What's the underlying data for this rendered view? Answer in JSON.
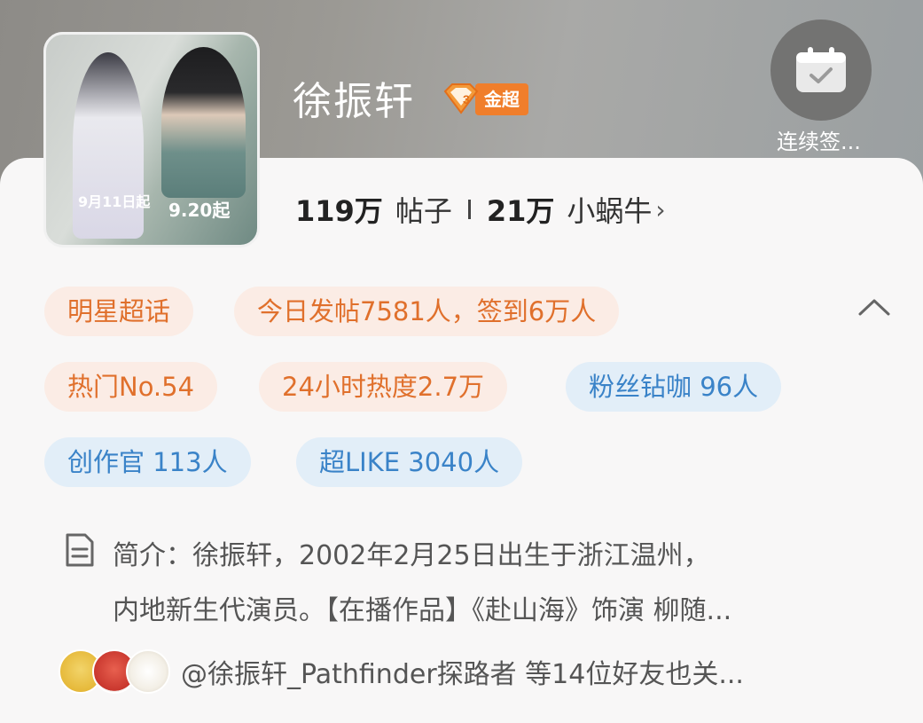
{
  "header": {
    "title": "徐振轩",
    "badge_level": "3",
    "badge_text": "金超",
    "checkin_label": "连续签...",
    "cover_dates": [
      "9月11日起",
      "9.20起"
    ]
  },
  "stats": {
    "posts_num": "119万",
    "posts_label": "帖子",
    "fans_num": "21万",
    "fans_label": "小蜗牛"
  },
  "chips": {
    "row1": [
      "明星超话",
      "今日发帖7581人，签到6万人"
    ],
    "row2": [
      "热门No.54",
      "24小时热度2.7万",
      "粉丝钻咖 96人"
    ],
    "row3": [
      "创作官 113人",
      "超LIKE 3040人"
    ]
  },
  "intro": {
    "line1": "简介：徐振轩，2002年2月25日出生于浙江温州，",
    "line2": "内地新生代演员。【在播作品】《赴山海》饰演 柳随..."
  },
  "friends": {
    "text": "@徐振轩_Pathfinder探路者 等14位好友也关..."
  },
  "colors": {
    "accent_orange": "#e0702c",
    "accent_blue": "#3a83c8",
    "badge": "#f07e2b"
  }
}
